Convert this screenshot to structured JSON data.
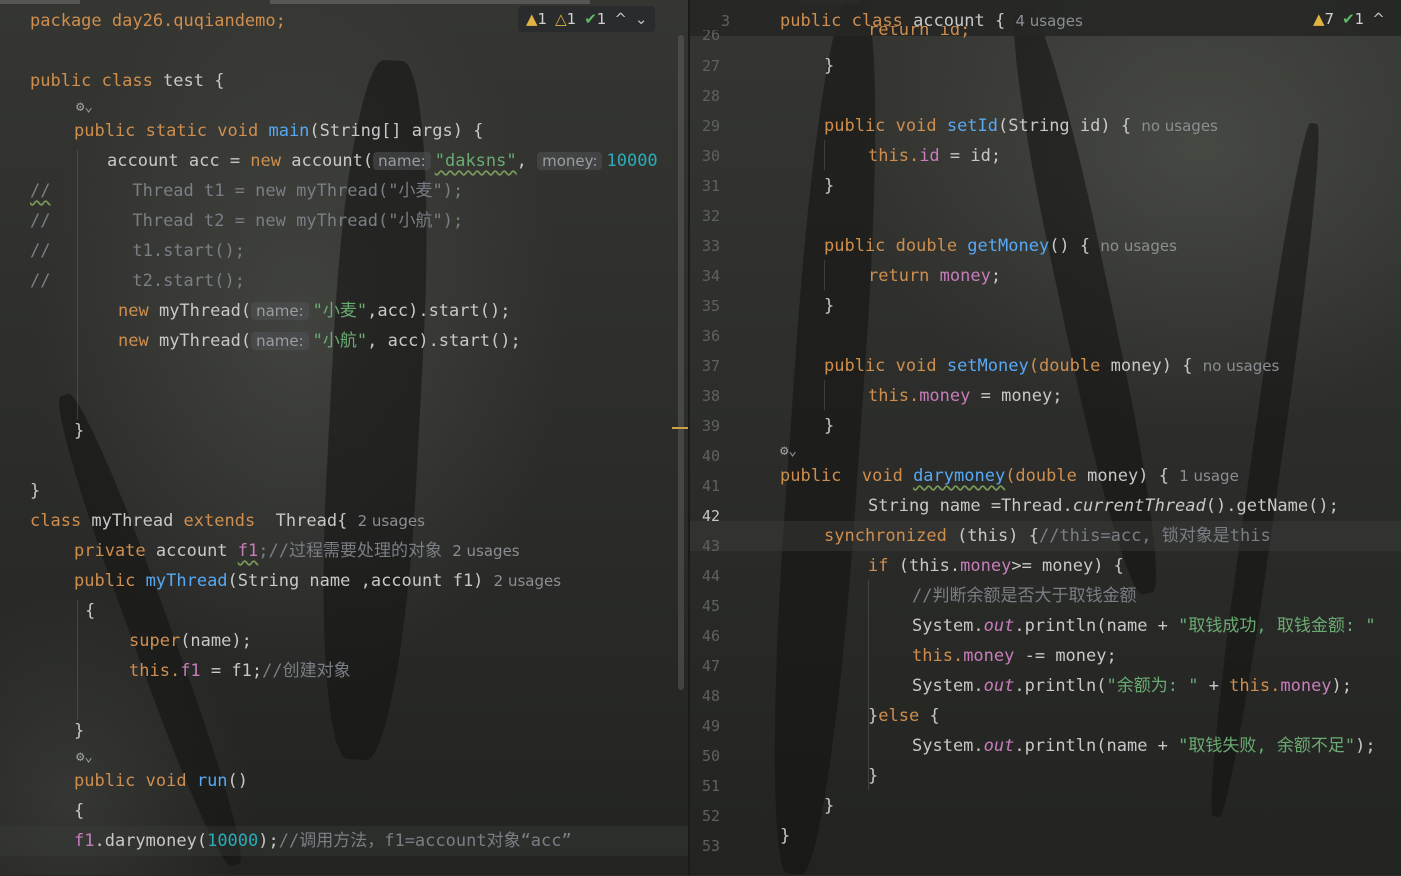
{
  "left": {
    "status": {
      "warn1": "1",
      "warn2": "1",
      "ok": "1",
      "up": "^",
      "down": "⌄"
    },
    "lines": {
      "l0": "package day26.quqiandemo;",
      "l2a": "public class ",
      "l2b": "test {",
      "l4a": "public static void ",
      "l4b": "main",
      "l4c": "(String[] args) {",
      "l5a": "account acc = ",
      "l5b": "new ",
      "l5c": "account(",
      "l5d": "name:",
      "l5e": "\"daksns\"",
      "l5f": ", ",
      "l5g": "money:",
      "l5h": "10000",
      "c1a": "//",
      "c1b": "        Thread t1 = new myThread(\"小麦\");",
      "c2a": "//",
      "c2b": "        Thread t2 = new myThread(\"小航\");",
      "c3a": "//",
      "c3b": "        t1.start();",
      "c4a": "//",
      "c4b": "        t2.start();",
      "n1a": "new ",
      "n1b": "myThread(",
      "n1c": "name:",
      "n1d": "\"小麦\"",
      "n1e": ",acc).start();",
      "n2a": "new ",
      "n2b": "myThread(",
      "n2c": "name:",
      "n2d": "\"小航\"",
      "n2e": ", acc).start();",
      "close1": "}",
      "close2": "}",
      "m1a": "class ",
      "m1b": "myThread ",
      "m1c": "extends ",
      "m1d": " Thread{",
      "m1e": "2 usages",
      "m2a": "private ",
      "m2b": "account ",
      "m2c": "f1",
      "m2d": ";//过程需要处理的对象",
      "m2e": "2 usages",
      "m3a": "public ",
      "m3b": "myThread",
      "m3c": "(String name ,account f1)",
      "m3d": "2 usages",
      "m4": "{",
      "m5a": "super",
      "m5b": "(name);",
      "m6a": "this.",
      "m6b": "f1",
      "m6c": " = f1;",
      "m6d": "//创建对象",
      "m7": "}",
      "m8a": "public void ",
      "m8b": "run",
      "m8c": "()",
      "m9": "{",
      "m10a": "f1",
      "m10b": ".darymoney(",
      "m10c": "10000",
      "m10d": ");",
      "m10e": "//调用方法，f1=account对象“acc”"
    }
  },
  "right": {
    "status": {
      "warn": "7",
      "ok": "1",
      "up": "^"
    },
    "header": {
      "num": "3",
      "a": "public class ",
      "b": "account {",
      "hint": "4 usages"
    },
    "gutter": [
      "26",
      "27",
      "28",
      "29",
      "30",
      "31",
      "32",
      "33",
      "34",
      "35",
      "36",
      "37",
      "38",
      "39",
      "40",
      "41",
      "42",
      "43",
      "44",
      "45",
      "46",
      "47",
      "48",
      "49",
      "50",
      "51",
      "52",
      "53"
    ],
    "lines": {
      "r26": "return id;",
      "r27": "}",
      "r29a": "public void ",
      "r29b": "setId",
      "r29c": "(String id) {",
      "r29d": "no usages",
      "r30a": "this.",
      "r30b": "id",
      "r30c": " = id;",
      "r31": "}",
      "r33a": "public double ",
      "r33b": "getMoney",
      "r33c": "() {",
      "r33d": "no usages",
      "r34a": "return ",
      "r34b": "money",
      "r34c": ";",
      "r35": "}",
      "r37a": "public void ",
      "r37b": "setMoney",
      "r37c": "(double ",
      "r37d": "money) {",
      "r37e": "no usages",
      "r38a": "this.",
      "r38b": "money",
      "r38c": " = money;",
      "r39": "}",
      "r40a": "public  void ",
      "r40b": "darymoney",
      "r40c": "(double ",
      "r40d": "money) {",
      "r40e": "1 usage",
      "r41a": "String name =Thread.",
      "r41b": "currentThread",
      "r41c": "().getName();",
      "r42a": "synchronized ",
      "r42b": "(this) {",
      "r42c": "//this=acc, 锁对象是this",
      "r43a": "if ",
      "r43b": "(this.",
      "r43c": "money",
      "r43d": ">= money) {",
      "r44": "//判断余额是否大于取钱金额",
      "r45a": "System.",
      "r45b": "out",
      "r45c": ".println(name + ",
      "r45d": "\"取钱成功, 取钱金额: \"",
      "r46a": "this.",
      "r46b": "money",
      "r46c": " -= money;",
      "r47a": "System.",
      "r47b": "out",
      "r47c": ".println(",
      "r47d": "\"余额为: \"",
      "r47e": " + ",
      "r47f": "this.",
      "r47g": "money",
      "r47h": ");",
      "r48a": "}",
      "r48b": "else ",
      "r48c": "{",
      "r49a": "System.",
      "r49b": "out",
      "r49c": ".println(name + ",
      "r49d": "\"取钱失败, 余额不足\"",
      "r49e": ");",
      "r50": "}",
      "r51": "}",
      "r52": "}"
    }
  }
}
